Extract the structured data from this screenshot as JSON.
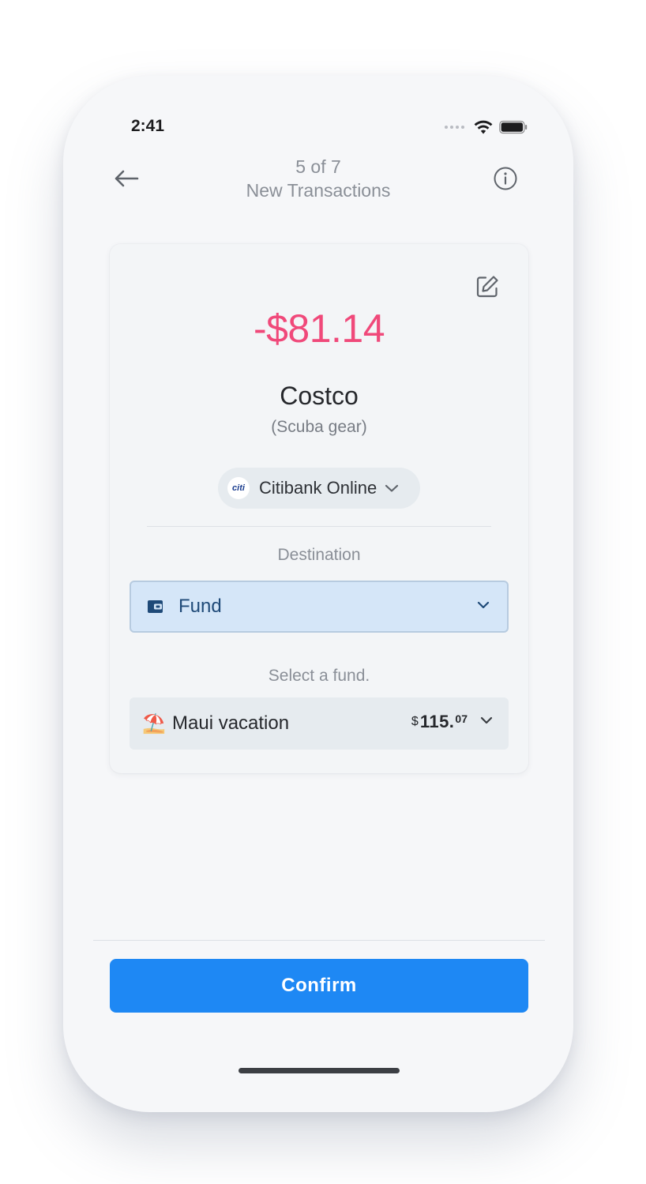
{
  "status_bar": {
    "time": "2:41"
  },
  "nav": {
    "counter": "5 of 7",
    "title": "New Transactions"
  },
  "transaction": {
    "amount": "-$81.14",
    "merchant": "Costco",
    "note": "(Scuba gear)",
    "account": {
      "logo_text": "citi",
      "label": "Citibank Online"
    }
  },
  "destination": {
    "label": "Destination",
    "selected": "Fund",
    "icon": "wallet-icon"
  },
  "fund": {
    "hint": "Select a fund.",
    "emoji": "⛱️",
    "name": "Maui vacation",
    "balance_currency": "$",
    "balance_main": "115.",
    "balance_cents": "07"
  },
  "footer": {
    "confirm_label": "Confirm"
  },
  "colors": {
    "amount_negative": "#f0497a",
    "primary_button": "#1e88f4",
    "destination_bg": "#d5e6f8",
    "destination_text": "#1f4a78"
  }
}
